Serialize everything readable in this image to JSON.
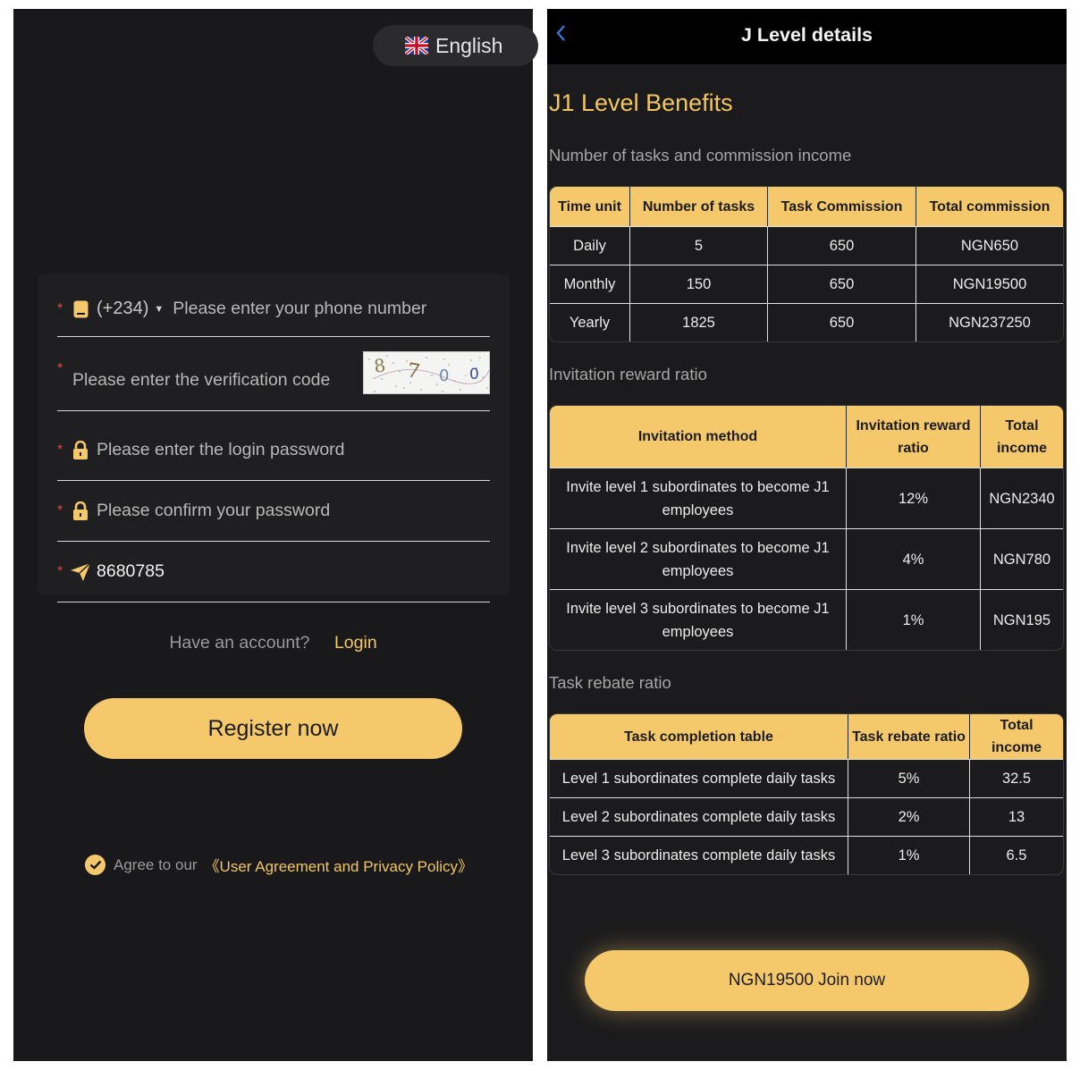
{
  "register": {
    "language": "English",
    "phone": {
      "country_code": "(+234)",
      "placeholder": "Please enter your phone number"
    },
    "verification": {
      "placeholder": "Please enter the verification code",
      "captcha_text": "8700"
    },
    "password": {
      "placeholder": "Please enter the login password"
    },
    "confirm_password": {
      "placeholder": "Please confirm your password"
    },
    "invite_code": {
      "value": "8680785"
    },
    "have_account": "Have an account?",
    "login_link": "Login",
    "register_button": "Register now",
    "agree_text": "Agree to our",
    "policy_link": "《User Agreement and Privacy Policy》"
  },
  "details": {
    "header_title": "J Level details",
    "level_title": "J1 Level Benefits",
    "tasks_section": {
      "title": "Number of tasks and commission income",
      "headers": [
        "Time unit",
        "Number of tasks",
        "Task Commission",
        "Total commission"
      ],
      "rows": [
        [
          "Daily",
          "5",
          "650",
          "NGN650"
        ],
        [
          "Monthly",
          "150",
          "650",
          "NGN19500"
        ],
        [
          "Yearly",
          "1825",
          "650",
          "NGN237250"
        ]
      ]
    },
    "invite_section": {
      "title": "Invitation reward ratio",
      "headers": [
        "Invitation method",
        "Invitation reward ratio",
        "Total income"
      ],
      "rows": [
        [
          "Invite level 1 subordinates to become J1 employees",
          "12%",
          "NGN2340"
        ],
        [
          "Invite level 2 subordinates to become J1 employees",
          "4%",
          "NGN780"
        ],
        [
          "Invite level 3 subordinates to become J1 employees",
          "1%",
          "NGN195"
        ]
      ]
    },
    "rebate_section": {
      "title": "Task rebate ratio",
      "headers": [
        "Task completion table",
        "Task rebate ratio",
        "Total income"
      ],
      "rows": [
        [
          "Level 1 subordinates complete daily tasks",
          "5%",
          "32.5"
        ],
        [
          "Level 2 subordinates complete daily tasks",
          "2%",
          "13"
        ],
        [
          "Level 3 subordinates complete daily tasks",
          "1%",
          "6.5"
        ]
      ]
    },
    "join_button": "NGN19500 Join now"
  },
  "colors": {
    "accent": "#f5c96b",
    "background": "#19191b",
    "required_star": "#e04a3b"
  },
  "icons": [
    "uk-flag-icon",
    "phone-icon",
    "caret-down-icon",
    "lock-icon",
    "paper-plane-icon",
    "check-circle-icon",
    "back-chevron-icon"
  ]
}
